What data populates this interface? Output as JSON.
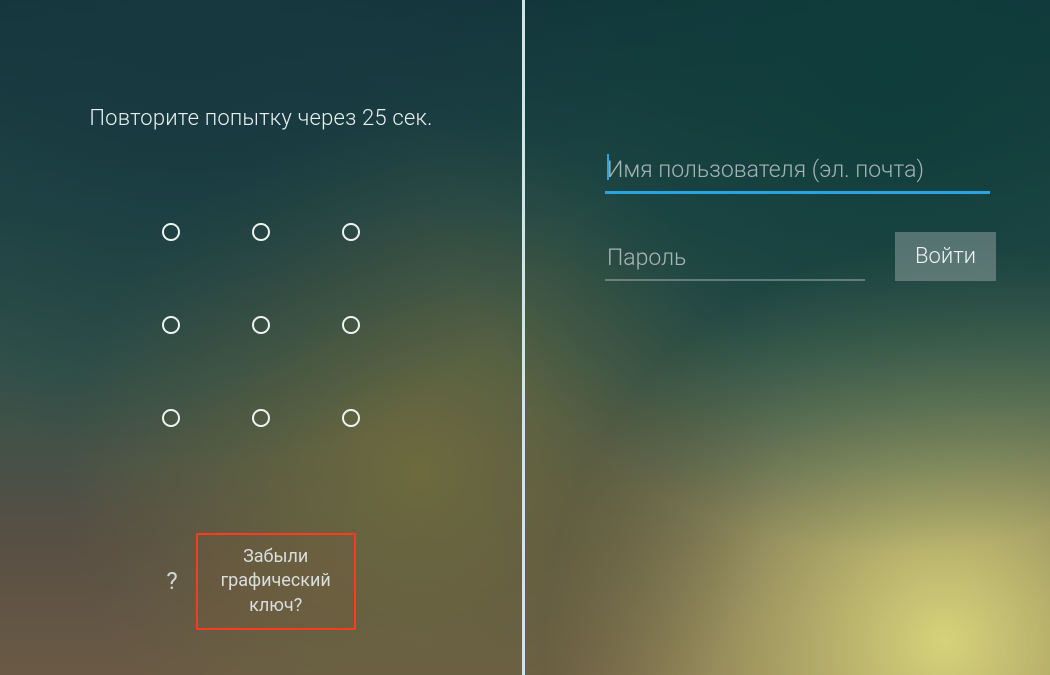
{
  "leftPane": {
    "retryMessage": "Повторите попытку через 25 сек.",
    "helpGlyph": "?",
    "forgotPatternLabel": "Забыли\nграфический\nключ?"
  },
  "rightPane": {
    "usernamePlaceholder": "Имя пользователя (эл. почта)",
    "passwordPlaceholder": "Пароль",
    "loginLabel": "Войти"
  }
}
